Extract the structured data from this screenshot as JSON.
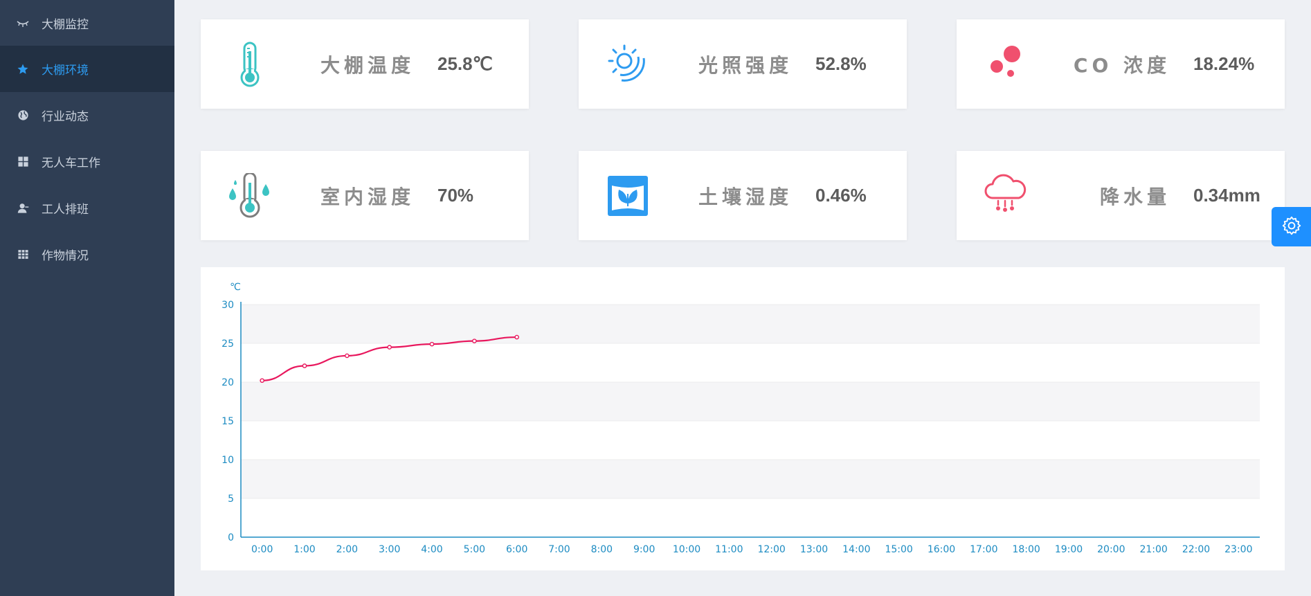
{
  "sidebar": {
    "items": [
      {
        "label": "大棚监控",
        "icon": "eye-closed-icon",
        "active": false
      },
      {
        "label": "大棚环境",
        "icon": "star-icon",
        "active": true
      },
      {
        "label": "行业动态",
        "icon": "globe-icon",
        "active": false
      },
      {
        "label": "无人车工作",
        "icon": "grid-icon",
        "active": false
      },
      {
        "label": "工人排班",
        "icon": "user-icon",
        "active": false
      },
      {
        "label": "作物情况",
        "icon": "table-icon",
        "active": false
      }
    ]
  },
  "cards": [
    {
      "label": "大棚温度",
      "value": "25.8℃",
      "icon": "thermometer-icon",
      "color": "#3cc3c3"
    },
    {
      "label": "光照强度",
      "value": "52.8%",
      "icon": "sun-icon",
      "color": "#2d9bf0"
    },
    {
      "label": "CO 浓度",
      "value": "18.24%",
      "icon": "dots-icon",
      "color": "#f0506e"
    },
    {
      "label": "室内湿度",
      "value": "70%",
      "icon": "humidity-thermometer-icon",
      "color": "#3cc3c3"
    },
    {
      "label": "土壤湿度",
      "value": "0.46%",
      "icon": "soil-leaf-icon",
      "color": "#2d9bf0"
    },
    {
      "label": "降水量",
      "value": "0.34mm",
      "icon": "rain-cloud-icon",
      "color": "#f0506e"
    }
  ],
  "settings": {
    "icon": "gear-icon",
    "color": "#1e90ff"
  },
  "chart_data": {
    "type": "line",
    "title": "",
    "ylabel": "℃",
    "xlabel": "",
    "ylim": [
      0,
      30
    ],
    "yticks": [
      0,
      5,
      10,
      15,
      20,
      25,
      30
    ],
    "categories": [
      "0:00",
      "1:00",
      "2:00",
      "3:00",
      "4:00",
      "5:00",
      "6:00",
      "7:00",
      "8:00",
      "9:00",
      "10:00",
      "11:00",
      "12:00",
      "13:00",
      "14:00",
      "15:00",
      "16:00",
      "17:00",
      "18:00",
      "19:00",
      "20:00",
      "21:00",
      "22:00",
      "23:00"
    ],
    "series": [
      {
        "color": "#e8175d",
        "values": [
          20.2,
          22.1,
          23.4,
          24.5,
          24.9,
          25.3,
          25.8
        ]
      }
    ],
    "grid": true,
    "axis_color": "#1c8bc2"
  }
}
